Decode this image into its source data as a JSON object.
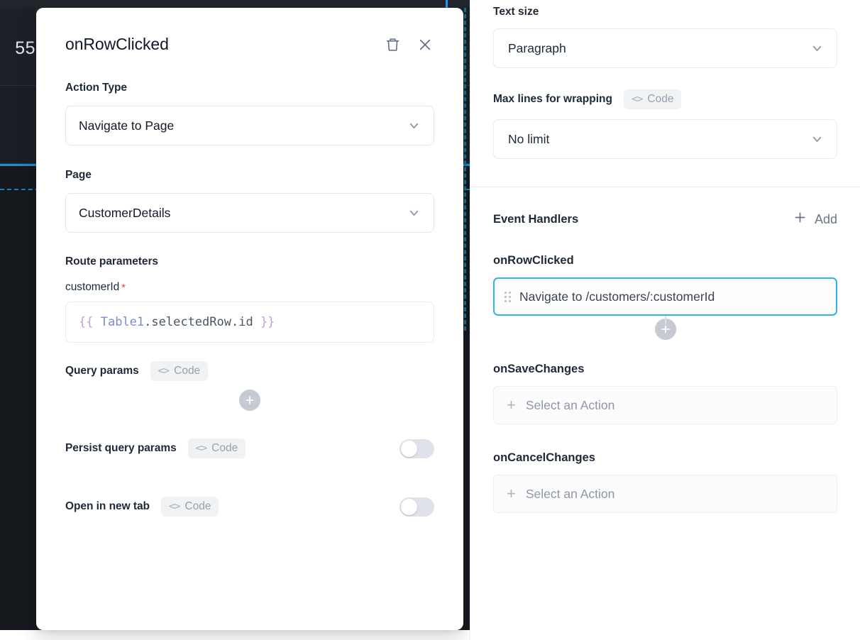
{
  "canvas": {
    "cell_value": "55"
  },
  "modal": {
    "title": "onRowClicked",
    "delete_icon": "trash-icon",
    "close_icon": "close-icon",
    "action_type": {
      "label": "Action Type",
      "value": "Navigate to Page"
    },
    "page": {
      "label": "Page",
      "value": "CustomerDetails"
    },
    "route_parameters": {
      "label": "Route parameters",
      "param_name": "customerId",
      "required_marker": "*",
      "value_tokens": {
        "open_brace": "{{",
        "identifier": "Table1",
        "rest": ".selectedRow.id",
        "close_brace": "}}"
      },
      "value_full": "{{ Table1.selectedRow.id }}"
    },
    "query_params": {
      "label": "Query params",
      "code_chip": "Code",
      "add_icon": "plus-icon"
    },
    "persist_query_params": {
      "label": "Persist query params",
      "code_chip": "Code",
      "enabled": false
    },
    "open_in_new_tab": {
      "label": "Open in new tab",
      "code_chip": "Code",
      "enabled": false
    }
  },
  "right_panel": {
    "text_size": {
      "label": "Text size",
      "value": "Paragraph"
    },
    "max_lines": {
      "label": "Max lines for wrapping",
      "code_chip": "Code",
      "value": "No limit"
    },
    "event_handlers": {
      "title": "Event Handlers",
      "add_label": "Add",
      "handlers": [
        {
          "name": "onRowClicked",
          "action_text": "Navigate to /customers/:customerId",
          "selected": true,
          "has_add_connector": true
        },
        {
          "name": "onSaveChanges",
          "placeholder": "Select an Action",
          "selected": false
        },
        {
          "name": "onCancelChanges",
          "placeholder": "Select an Action",
          "selected": false
        }
      ]
    }
  },
  "colors": {
    "accent_blue": "#2fb2ee",
    "canvas_dark": "#15181c",
    "required_red": "#ef4444",
    "token_brace": "#b9a4d8",
    "token_identifier": "#7a8bd6"
  }
}
